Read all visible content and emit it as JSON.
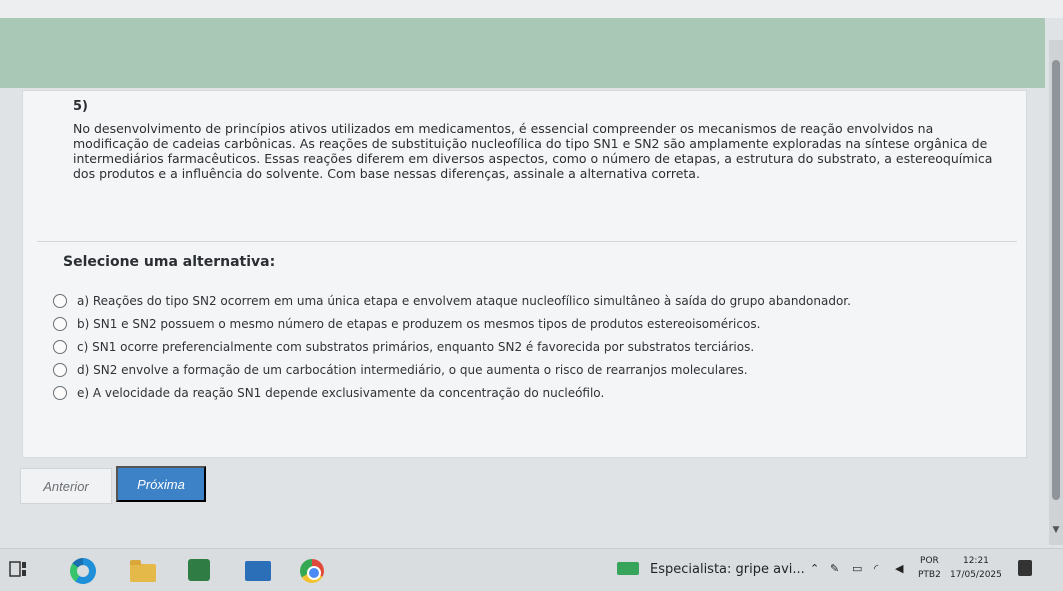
{
  "question": {
    "number": "5)",
    "statement": "No desenvolvimento de princípios ativos utilizados em medicamentos, é essencial compreender os mecanismos de reação envolvidos na modificação de cadeias carbônicas. As reações de substituição nucleofílica do tipo SN1 e SN2 são amplamente exploradas na síntese orgânica de intermediários farmacêuticos. Essas reações diferem em diversos aspectos, como o número de etapas, a estrutura do substrato, a estereoquímica dos produtos e a influência do solvente. Com base nessas diferenças, assinale a alternativa correta.",
    "select_label": "Selecione uma alternativa:",
    "options": [
      "a) Reações do tipo SN2 ocorrem em uma única etapa e envolvem ataque nucleofílico simultâneo à saída do grupo abandonador.",
      "b) SN1 e SN2 possuem o mesmo número de etapas e produzem os mesmos tipos de produtos estereoisoméricos.",
      "c) SN1 ocorre preferencialmente com substratos primários, enquanto SN2 é favorecida por substratos terciários.",
      "d) SN2 envolve a formação de um carbocátion intermediário, o que aumenta o risco de rearranjos moleculares.",
      "e) A velocidade da reação SN1 depende exclusivamente da concentração do nucleófilo."
    ]
  },
  "nav": {
    "prev_label": "Anterior",
    "next_label": "Próxima"
  },
  "taskbar": {
    "widget_text": "Especialista: gripe avi...",
    "lang_line1": "POR",
    "lang_line2": "PTB2",
    "time": "12:21",
    "date": "17/05/2025"
  },
  "colors": {
    "accent": "#3d82c6",
    "band": "#a9c9b6"
  }
}
